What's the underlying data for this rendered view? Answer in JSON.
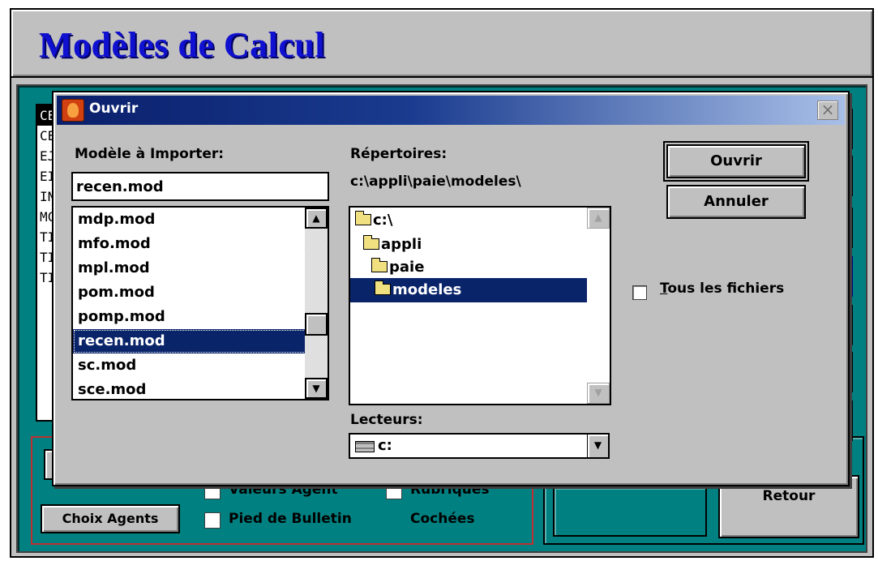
{
  "app": {
    "title": "Modèles de Calcul"
  },
  "background": {
    "model_list": [
      "CE",
      "CE",
      "EJ",
      "EI",
      "IN",
      "MC",
      "TI",
      "TI",
      "TI"
    ],
    "selected_model_index": 0,
    "choose_agents_label": "Choix Agents",
    "options": {
      "agent_values_label": "Valeurs Agent",
      "headings_label": "Rubriques",
      "payslip_footer_label": "Pied de Bulletin",
      "checked_label": "Cochées"
    },
    "return_label": "Retour"
  },
  "dialog": {
    "title": "Ouvrir",
    "close_symbol": "×",
    "model_label": "Modèle à Importer:",
    "filename_value": "recen.mod",
    "files": [
      "mdp.mod",
      "mfo.mod",
      "mpl.mod",
      "pom.mod",
      "pomp.mod",
      "recen.mod",
      "sc.mod",
      "sce.mod"
    ],
    "selected_file": "recen.mod",
    "directories_label": "Répertoires:",
    "current_path": "c:\\appli\\paie\\modeles\\",
    "directories": [
      {
        "name": "c:\\",
        "level": 0
      },
      {
        "name": "appli",
        "level": 1
      },
      {
        "name": "paie",
        "level": 2
      },
      {
        "name": "modeles",
        "level": 3
      }
    ],
    "selected_directory": "modeles",
    "drives_label": "Lecteurs:",
    "drive_value": "c:",
    "open_label": "Ouvrir",
    "cancel_label": "Annuler",
    "all_files_mnemonic": "T",
    "all_files_label_rest": "ous les fichiers",
    "all_files_checked": false
  },
  "icons": {
    "dialog_icon": "app-fox-icon",
    "folder": "folder-icon",
    "drive": "hard-drive-icon",
    "scroll_up": "scroll-up-arrow-icon",
    "scroll_down": "scroll-down-arrow-icon",
    "dropdown": "chevron-down-icon"
  },
  "colors": {
    "workspace": "#008080",
    "selection": "#0a246a",
    "title_text": "#1010d0",
    "options_border": "#c03030"
  }
}
